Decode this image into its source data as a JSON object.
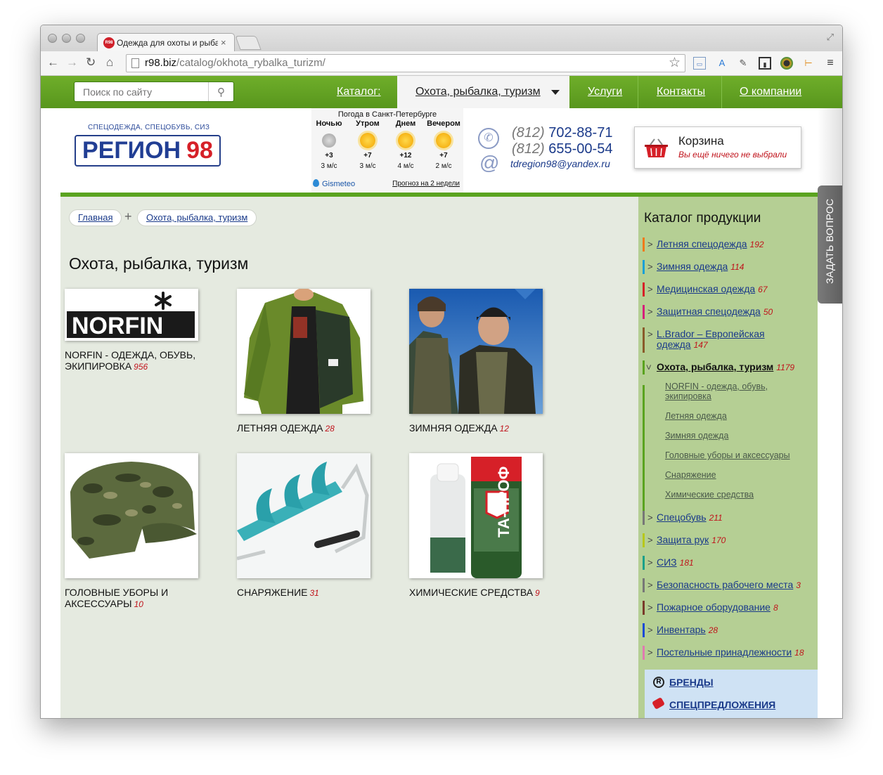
{
  "browser": {
    "tab_title": "Одежда для охоты и рыбалки",
    "favicon_text": "R98",
    "url_host": "r98.biz",
    "url_path": "/catalog/okhota_rybalka_turizm/"
  },
  "nav": {
    "search_placeholder": "Поиск по сайту",
    "catalog": "Каталог:",
    "active": "Охота, рыбалка, туризм",
    "services": "Услуги",
    "contacts": "Контакты",
    "about": "О компании"
  },
  "header": {
    "tagline": "СПЕЦОДЕЖДА, СПЕЦОБУВЬ, СИЗ",
    "logo_word": "РЕГИОН",
    "logo_num": "98",
    "phone1_code": "(812)",
    "phone1_num": "702-88-71",
    "phone2_code": "(812)",
    "phone2_num": "655-00-54",
    "email": "tdregion98@yandex.ru",
    "cart_title": "Корзина",
    "cart_sub": "Вы ещё ничего не выбрали"
  },
  "weather": {
    "title": "Погода в Санкт-Петербурге",
    "periods": [
      {
        "label": "Ночью",
        "temp": "+3",
        "wind": "3 м/с",
        "icon": "moon-icon"
      },
      {
        "label": "Утром",
        "temp": "+7",
        "wind": "3 м/с",
        "icon": "sun-icon"
      },
      {
        "label": "Днем",
        "temp": "+12",
        "wind": "4 м/с",
        "icon": "sun-icon"
      },
      {
        "label": "Вечером",
        "temp": "+7",
        "wind": "2 м/с",
        "icon": "sun-icon"
      }
    ],
    "provider": "Gismeteo",
    "forecast_link": "Прогноз на 2 недели"
  },
  "breadcrumbs": [
    "Главная",
    "Охота, рыбалка, туризм"
  ],
  "page_title": "Охота, рыбалка, туризм",
  "products": [
    {
      "caption": "NORFIN - одежда, обувь, экипировка",
      "count": "956",
      "logo_text": "NORFIN"
    },
    {
      "caption": "Летняя одежда",
      "count": "28"
    },
    {
      "caption": "Зимняя одежда",
      "count": "12"
    },
    {
      "caption": "Головные уборы и аксессуары",
      "count": "10"
    },
    {
      "caption": "Снаряжение",
      "count": "31"
    },
    {
      "caption": "Химические средства",
      "count": "9",
      "label_text": "ТА-ПРОФ"
    }
  ],
  "sidebar": {
    "title": "Каталог продукции",
    "items": [
      {
        "label": "Летняя спецодежда",
        "count": "192",
        "color": "#f07a1a"
      },
      {
        "label": "Зимняя одежда",
        "count": "114",
        "color": "#1aa0d6"
      },
      {
        "label": "Медицинская одежда",
        "count": "67",
        "color": "#d62028"
      },
      {
        "label": "Защитная спецодежда",
        "count": "50",
        "color": "#d6207a"
      },
      {
        "label": "L.Brador – Европейская одежда",
        "count": "147",
        "color": "#8a5a2a"
      },
      {
        "label": "Охота, рыбалка, туризм",
        "count": "1179",
        "color": "#5aa31f"
      },
      {
        "label": "Спецобувь",
        "count": "211",
        "color": "#777777"
      },
      {
        "label": "Защита рук",
        "count": "170",
        "color": "#b8c81a"
      },
      {
        "label": "СИЗ",
        "count": "181",
        "color": "#1aa08a"
      },
      {
        "label": "Безопасность рабочего места",
        "count": "3",
        "color": "#777777"
      },
      {
        "label": "Пожарное оборудование",
        "count": "8",
        "color": "#7a3a2a"
      },
      {
        "label": "Инвентарь",
        "count": "28",
        "color": "#1a4ad6"
      },
      {
        "label": "Постельные принадлежности",
        "count": "18",
        "color": "#e07ab0"
      }
    ],
    "subitems": [
      "NORFIN - одежда, обувь, экипировка",
      "Летняя одежда",
      "Зимняя одежда",
      "Головные уборы и аксессуары",
      "Снаряжение",
      "Химические средства"
    ],
    "brands": "БРЕНДЫ",
    "specials": "СПЕЦПРЕДЛОЖЕНИЯ"
  },
  "ask_question": "ЗАДАТЬ ВОПРОС"
}
